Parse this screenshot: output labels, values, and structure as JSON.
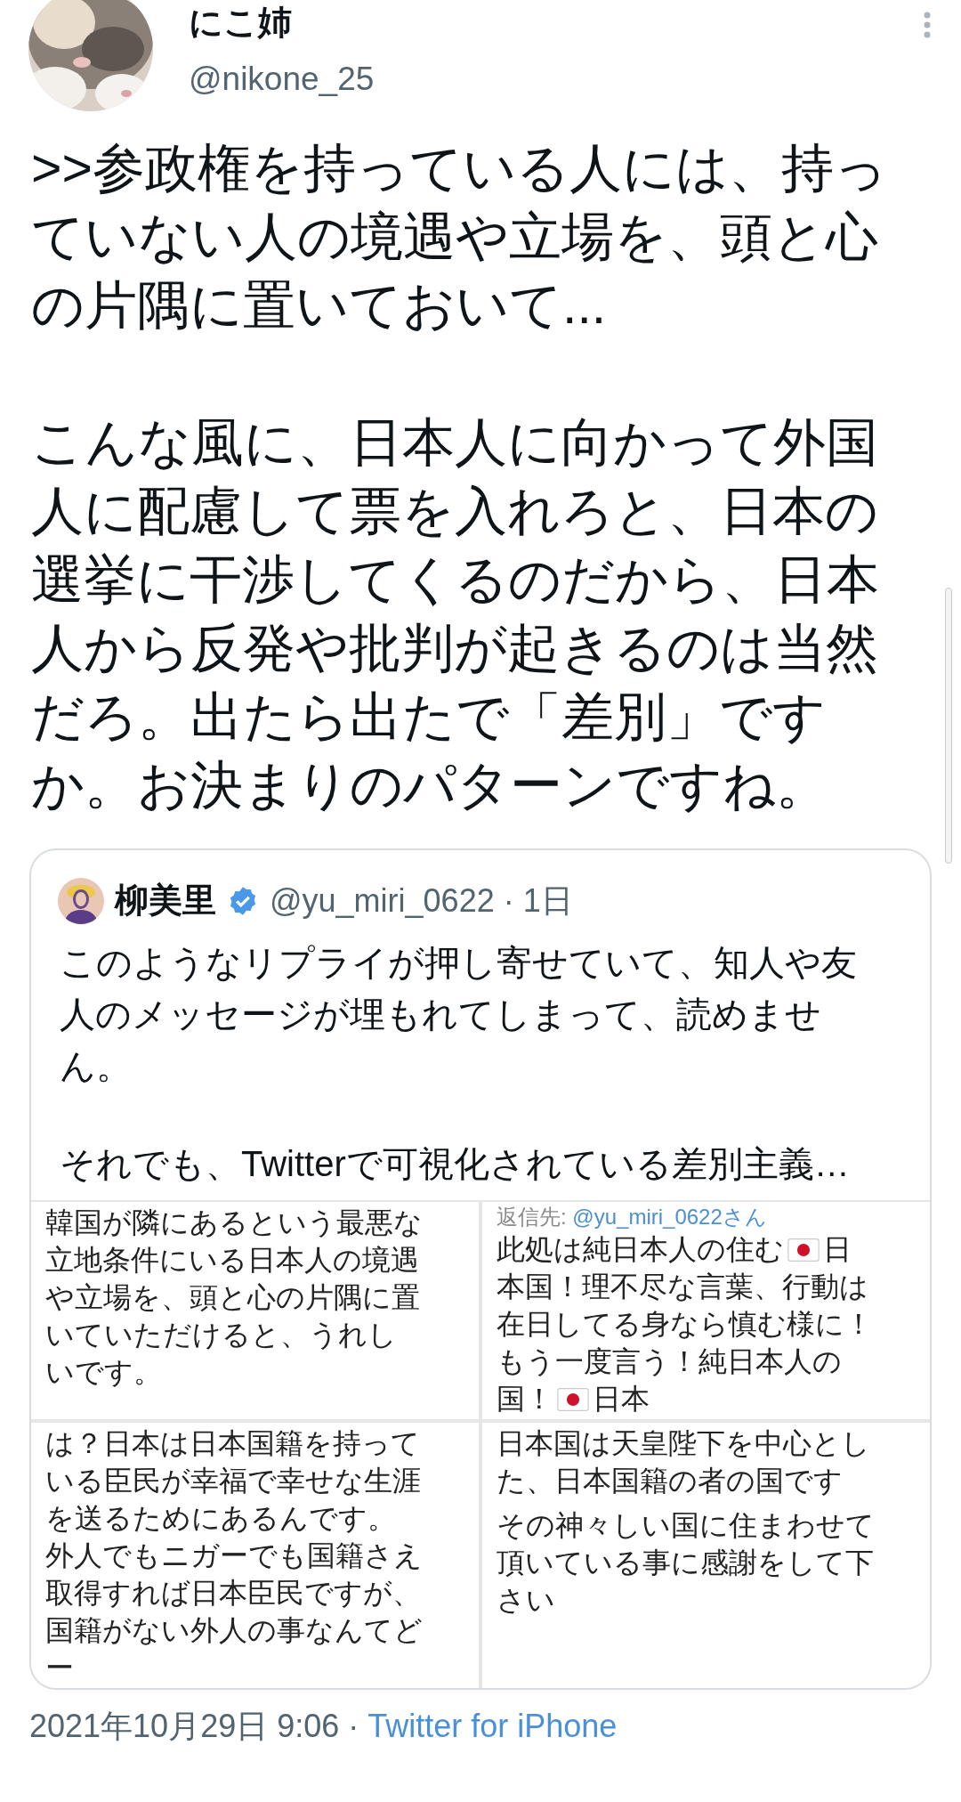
{
  "author": {
    "name": "にこ姉",
    "handle": "@nikone_25"
  },
  "text_paragraphs": [
    ">>参政権を持っている人には、持っていない人の境遇や立場を、頭と心の片隅に置いておいて...",
    "こんな風に、日本人に向かって外国人に配慮して票を入れろと、日本の選挙に干渉してくるのだから、日本人から反発や批判が起きるのは当然だろ。出たら出たで「差別」ですか。お決まりのパターンですね。"
  ],
  "quoted_tweet": {
    "author": {
      "name": "柳美里",
      "verified": true,
      "handle": "@yu_miri_0622",
      "meta": "· 1日"
    },
    "text_paragraphs": [
      "このようなリプライが押し寄せていて、知人や友人のメッセージが埋もれてしまって、読めません。",
      "それでも、Twitterで可視化されている差別主義…"
    ],
    "images": [
      {
        "paragraphs": [
          [
            {
              "kind": "text",
              "text": "韓国が隣にあるという最悪な立地条件にいる日本人の境遇や立場を、頭と心の片隅に置いていただけると、うれしいです。"
            }
          ]
        ]
      },
      {
        "reply_to": {
          "label": "返信先:",
          "handle": "@yu_miri_0622さん"
        },
        "paragraphs": [
          [
            {
              "kind": "text",
              "text": "此処は純日本人の住む"
            },
            {
              "kind": "flag"
            },
            {
              "kind": "text",
              "text": "日本国！理不尽な言葉、行動は在日してる身なら慎む様に！もう一度言う！純日本人の国！"
            },
            {
              "kind": "flag"
            },
            {
              "kind": "text",
              "text": "日本"
            }
          ]
        ]
      },
      {
        "paragraphs": [
          [
            {
              "kind": "text",
              "text": "は？日本は日本国籍を持っている臣民が幸福で幸せな生涯を送るためにあるんです。外人でもニガーでも国籍さえ取得すれば日本臣民ですが、国籍がない外人の事なんてどー"
            }
          ]
        ]
      },
      {
        "paragraphs": [
          [
            {
              "kind": "text",
              "text": "日本国は天皇陛下を中心とした、日本国籍の者の国です"
            }
          ],
          [
            {
              "kind": "text",
              "text": "その神々しい国に住まわせて頂いている事に感謝をして下さい"
            }
          ]
        ]
      }
    ]
  },
  "timestamp": "2021年10月29日 9:06 ·",
  "source": "Twitter for iPhone"
}
